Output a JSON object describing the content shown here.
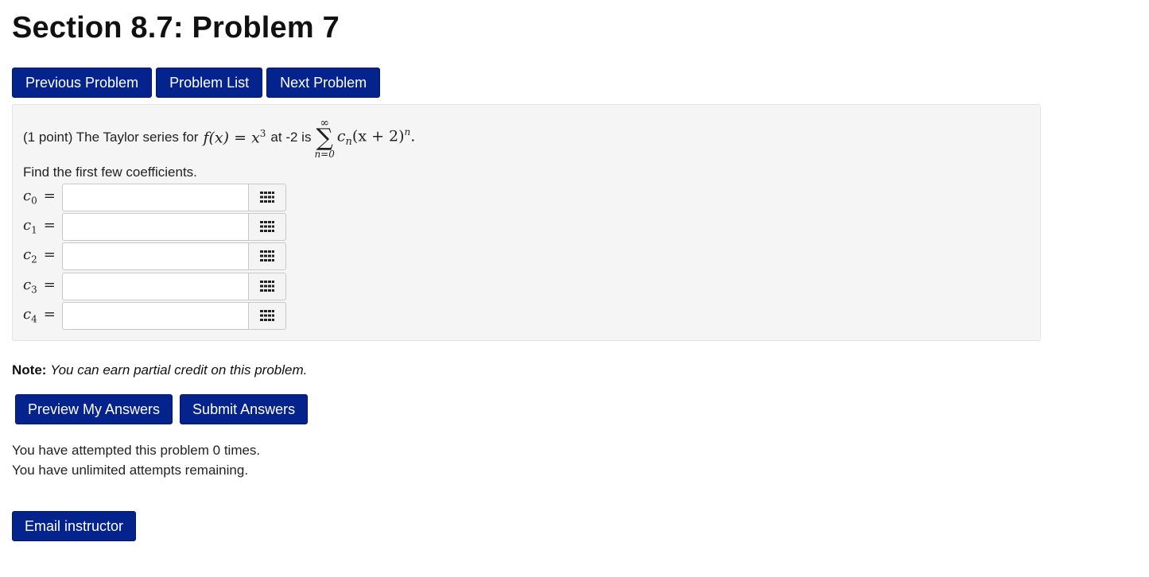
{
  "page": {
    "title": "Section 8.7: Problem 7"
  },
  "nav": {
    "previous_label": "Previous Problem",
    "list_label": "Problem List",
    "next_label": "Next Problem"
  },
  "problem": {
    "points_prefix": "(1 point) The Taylor series for",
    "function_lhs": "f(x)",
    "function_rhs": "x",
    "function_exponent": "3",
    "at_text": "at -2 is",
    "sum_upper": "∞",
    "sum_lower": "n=0",
    "term_base": "c",
    "term_sub": "n",
    "term_paren": "(x + 2)",
    "term_exponent": "n",
    "term_end": ".",
    "instruction": "Find the first few coefficients.",
    "coefficients": [
      {
        "symbol": "c",
        "index": "0",
        "value": ""
      },
      {
        "symbol": "c",
        "index": "1",
        "value": ""
      },
      {
        "symbol": "c",
        "index": "2",
        "value": ""
      },
      {
        "symbol": "c",
        "index": "3",
        "value": ""
      },
      {
        "symbol": "c",
        "index": "4",
        "value": ""
      }
    ]
  },
  "note": {
    "label": "Note:",
    "text": "You can earn partial credit on this problem."
  },
  "actions": {
    "preview_label": "Preview My Answers",
    "submit_label": "Submit Answers"
  },
  "attempts": {
    "line1": "You have attempted this problem 0 times.",
    "line2": "You have unlimited attempts remaining."
  },
  "footer": {
    "email_label": "Email instructor"
  },
  "colors": {
    "button_bg": "#05238c",
    "panel_bg": "#f5f5f5"
  },
  "icons": {
    "equation_editor": "grid-icon"
  }
}
